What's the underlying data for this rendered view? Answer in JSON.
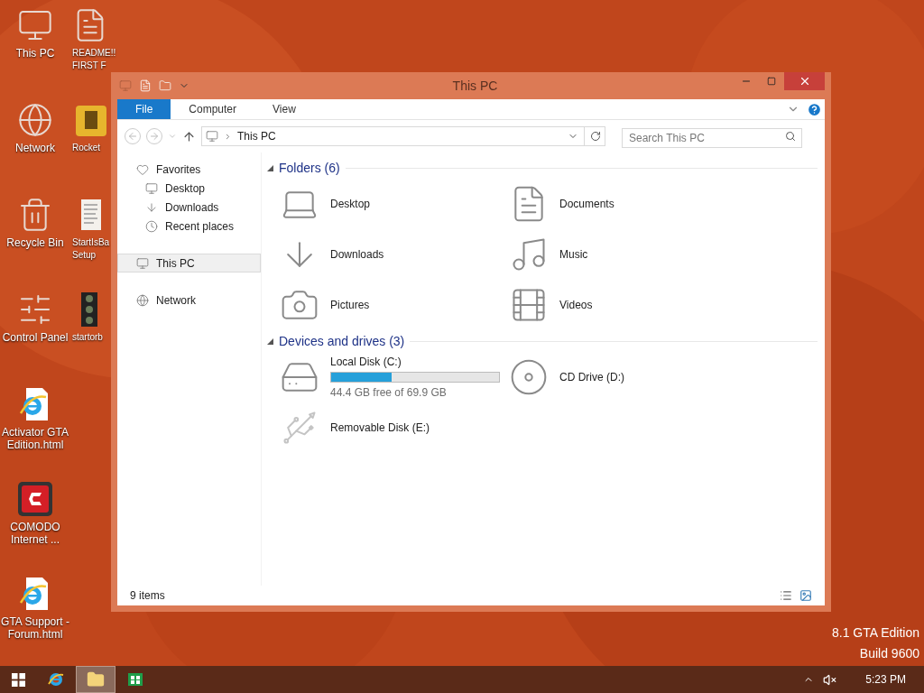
{
  "desktop": {
    "columns": [
      {
        "icons": [
          {
            "kind": "pc",
            "label": "This PC"
          },
          {
            "kind": "network",
            "label": "Network"
          },
          {
            "kind": "recycle",
            "label": "Recycle Bin"
          },
          {
            "kind": "control",
            "label": "Control Panel"
          },
          {
            "kind": "ie",
            "label": "Activator GTA Edition.html"
          },
          {
            "kind": "comodo",
            "label": "COMODO Internet ..."
          },
          {
            "kind": "ie",
            "label": "GTA Support - Forum.html"
          }
        ]
      },
      {
        "icons": [
          {
            "kind": "readme",
            "label": "README!!\nFIRST F"
          },
          {
            "kind": "rocket",
            "label": "Rocket"
          },
          {
            "kind": "setup",
            "label": "StartIsBa\nSetup"
          },
          {
            "kind": "startorb",
            "label": "startorb"
          }
        ]
      }
    ],
    "edition": [
      "8.1 GTA Edition",
      "Build 9600"
    ]
  },
  "window": {
    "title": "This PC",
    "ribbon_tabs": [
      {
        "label": "File",
        "selected": true
      },
      {
        "label": "Computer",
        "selected": false
      },
      {
        "label": "View",
        "selected": false
      }
    ],
    "address": "This PC",
    "search": {
      "placeholder": "Search This PC"
    },
    "navigation": [
      {
        "kind": "favorites",
        "label": "Favorites",
        "selected": false,
        "children": [
          {
            "kind": "desktop",
            "label": "Desktop",
            "selected": false
          },
          {
            "kind": "downloads",
            "label": "Downloads",
            "selected": false
          },
          {
            "kind": "recent",
            "label": "Recent places",
            "selected": false
          }
        ]
      },
      {
        "kind": "pc",
        "label": "This PC",
        "selected": true
      },
      {
        "kind": "network",
        "label": "Network",
        "selected": false
      }
    ],
    "sections": [
      {
        "title": "Folders (6)",
        "items": [
          {
            "kind": "desktop",
            "name": "Desktop"
          },
          {
            "kind": "documents",
            "name": "Documents"
          },
          {
            "kind": "downloads",
            "name": "Downloads"
          },
          {
            "kind": "music",
            "name": "Music"
          },
          {
            "kind": "pictures",
            "name": "Pictures"
          },
          {
            "kind": "videos",
            "name": "Videos"
          }
        ]
      },
      {
        "title": "Devices and drives (3)",
        "items": [
          {
            "kind": "disk",
            "name": "Local Disk (C:)",
            "level": 0.36,
            "detail": "44.4 GB free of 69.9 GB"
          },
          {
            "kind": "cd",
            "name": "CD Drive (D:)"
          },
          {
            "kind": "usb",
            "name": "Removable Disk (E:)"
          }
        ]
      }
    ],
    "status_bar": "9 items"
  },
  "taskbar": {
    "apps": [
      {
        "kind": "ie",
        "selected": false
      },
      {
        "kind": "explorer",
        "selected": true
      },
      {
        "kind": "store",
        "selected": false
      }
    ],
    "clock": "5:23 PM"
  }
}
